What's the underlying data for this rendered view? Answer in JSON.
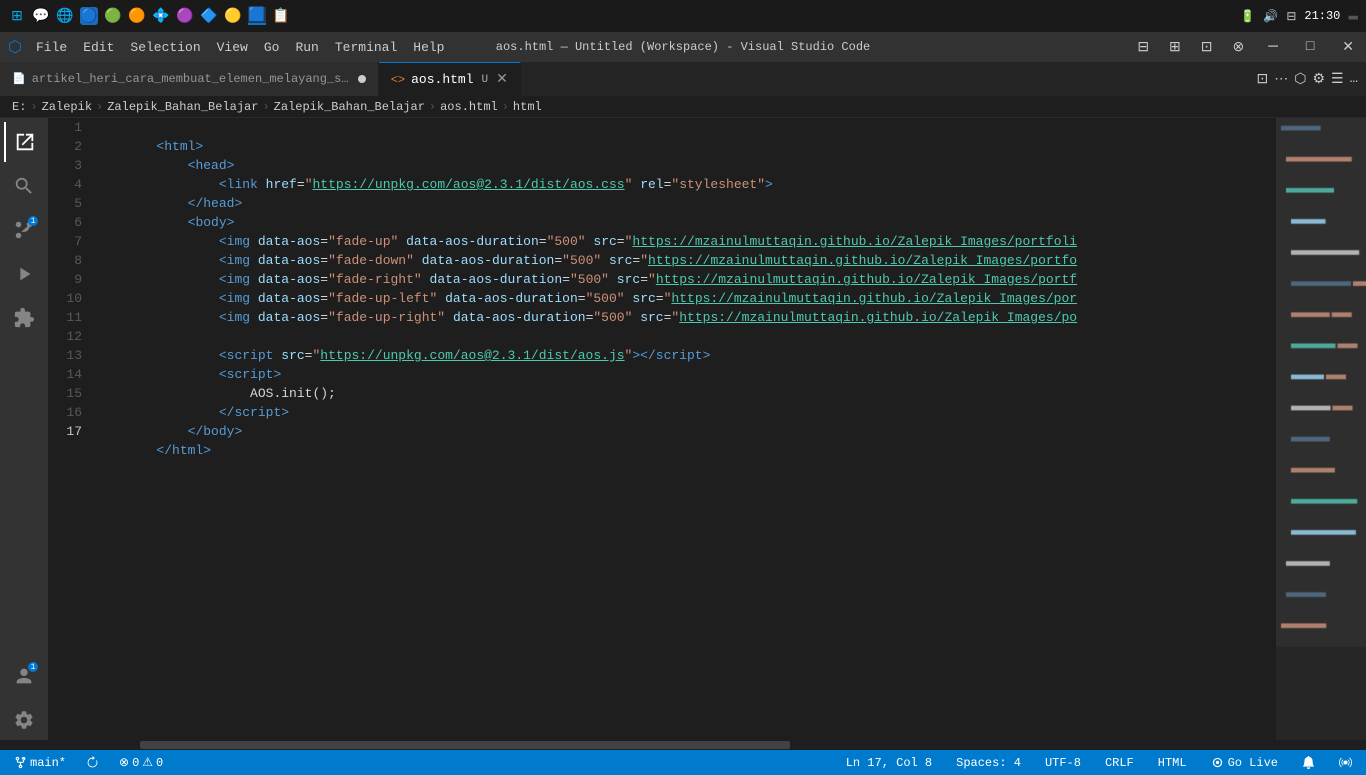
{
  "taskbar": {
    "icons": [
      "⊞",
      "💬",
      "🌐",
      "🔵",
      "🟢",
      "🟠",
      "💠",
      "🟣",
      "🔷",
      "🟡",
      "🟦"
    ],
    "time": "21:30",
    "battery": "🔋",
    "volume": "🔊",
    "network": "📶"
  },
  "titlebar": {
    "title": "aos.html — Untitled (Workspace) - Visual Studio Code",
    "menu": [
      "File",
      "Edit",
      "Selection",
      "View",
      "Go",
      "Run",
      "Terminal",
      "Help"
    ]
  },
  "tabs": [
    {
      "name": "artikel_heri_cara_membuat_elemen_melayang_saat_di_scroll.md",
      "active": false,
      "unsaved": true,
      "icon": "📄"
    },
    {
      "name": "aos.html",
      "active": true,
      "unsaved": true,
      "icon": "<>"
    }
  ],
  "breadcrumb": {
    "items": [
      "E:",
      "Zalepik",
      "Zalepik_Bahan_Belajar",
      "Zalepik_Bahan_Belajar",
      "aos.html",
      "html"
    ]
  },
  "code": {
    "lines": [
      {
        "num": 1,
        "content": "<html>"
      },
      {
        "num": 2,
        "content": "    <head>"
      },
      {
        "num": 3,
        "content": "        <link href=\"https://unpkg.com/aos@2.3.1/dist/aos.css\" rel=\"stylesheet\">"
      },
      {
        "num": 4,
        "content": "    </head>"
      },
      {
        "num": 5,
        "content": "    <body>"
      },
      {
        "num": 6,
        "content": "        <img data-aos=\"fade-up\" data-aos-duration=\"500\" src=\"https://mzainulmuttaqin.github.io/Zalepik_Images/portfoli"
      },
      {
        "num": 7,
        "content": "        <img data-aos=\"fade-down\" data-aos-duration=\"500\" src=\"https://mzainulmuttaqin.github.io/Zalepik_Images/portfo"
      },
      {
        "num": 8,
        "content": "        <img data-aos=\"fade-right\" data-aos-duration=\"500\" src=\"https://mzainulmuttaqin.github.io/Zalepik_Images/portf"
      },
      {
        "num": 9,
        "content": "        <img data-aos=\"fade-up-left\" data-aos-duration=\"500\" src=\"https://mzainulmuttaqin.github.io/Zalepik_Images/por"
      },
      {
        "num": 10,
        "content": "        <img data-aos=\"fade-up-right\" data-aos-duration=\"500\" src=\"https://mzainulmuttaqin.github.io/Zalepik_Images/po"
      },
      {
        "num": 11,
        "content": ""
      },
      {
        "num": 12,
        "content": "        <script src=\"https://unpkg.com/aos@2.3.1/dist/aos.js\"><\\/script>"
      },
      {
        "num": 13,
        "content": "        <script>"
      },
      {
        "num": 14,
        "content": "            AOS.init();"
      },
      {
        "num": 15,
        "content": "        <\\/script>"
      },
      {
        "num": 16,
        "content": "    </body>"
      },
      {
        "num": 17,
        "content": "</html>"
      }
    ]
  },
  "statusbar": {
    "branch": "main*",
    "sync": "🔄",
    "errors": "0",
    "warnings": "0",
    "position": "Ln 17, Col 8",
    "spaces": "Spaces: 4",
    "encoding": "UTF-8",
    "line_ending": "CRLF",
    "language": "HTML",
    "go_live": "Go Live",
    "notifications": "🔔"
  }
}
